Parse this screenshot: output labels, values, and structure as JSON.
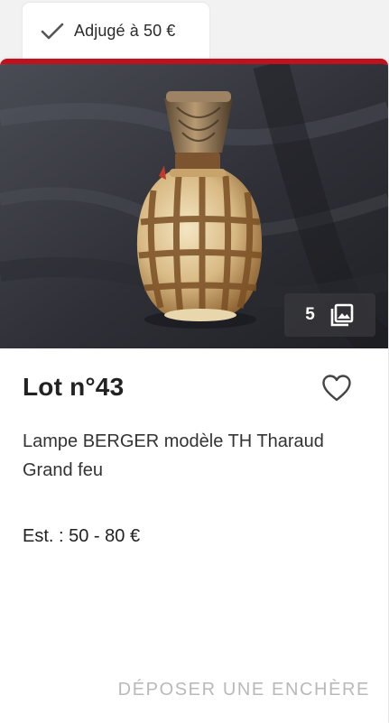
{
  "status_tab": {
    "label": "Adjugé à 50 €",
    "icon": "check-icon"
  },
  "card": {
    "accent_color": "#c0111f",
    "photo": {
      "description_icon": "gallery-icon",
      "count": "5"
    },
    "title": "Lot n°43",
    "favorite_icon": "heart-outline-icon",
    "description": "Lampe BERGER modèle TH Tharaud Grand feu",
    "estimate": "Est. : 50 - 80 €",
    "bid_button_label": "DÉPOSER UNE ENCHÈRE"
  }
}
